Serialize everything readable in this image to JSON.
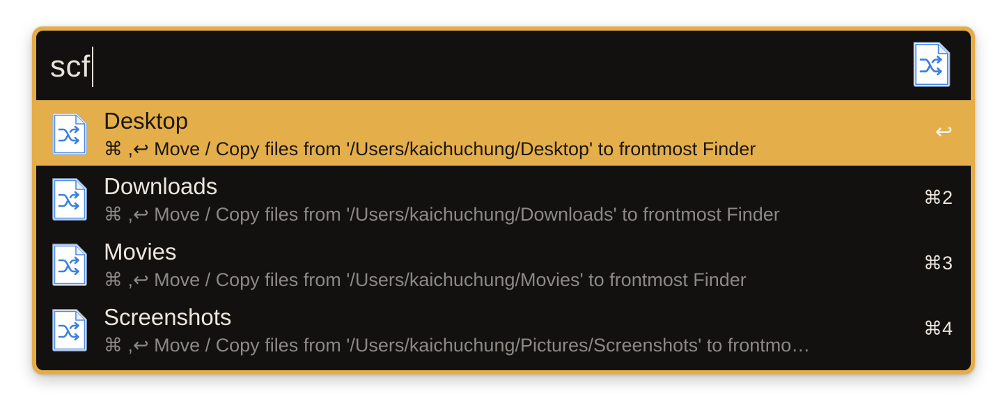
{
  "search": {
    "query": "scf"
  },
  "colors": {
    "accent": "#e4ae4a",
    "background": "#121110",
    "title_text": "#ece6dc",
    "subtitle_text": "#8c8985",
    "icon_blue": "#3b82f6"
  },
  "workflow_icon": "file-shuffle-icon",
  "results": [
    {
      "title": "Desktop",
      "subtitle": "⌘ ,↩ Move / Copy files from '/Users/kaichuchung/Desktop' to frontmost Finder",
      "shortcut": "↩",
      "selected": true
    },
    {
      "title": "Downloads",
      "subtitle": "⌘ ,↩ Move / Copy files from '/Users/kaichuchung/Downloads' to frontmost Finder",
      "shortcut": "⌘2",
      "selected": false
    },
    {
      "title": "Movies",
      "subtitle": "⌘ ,↩ Move / Copy files from '/Users/kaichuchung/Movies' to frontmost Finder",
      "shortcut": "⌘3",
      "selected": false
    },
    {
      "title": "Screenshots",
      "subtitle": "⌘ ,↩ Move / Copy files from '/Users/kaichuchung/Pictures/Screenshots' to frontmo…",
      "shortcut": "⌘4",
      "selected": false
    }
  ]
}
